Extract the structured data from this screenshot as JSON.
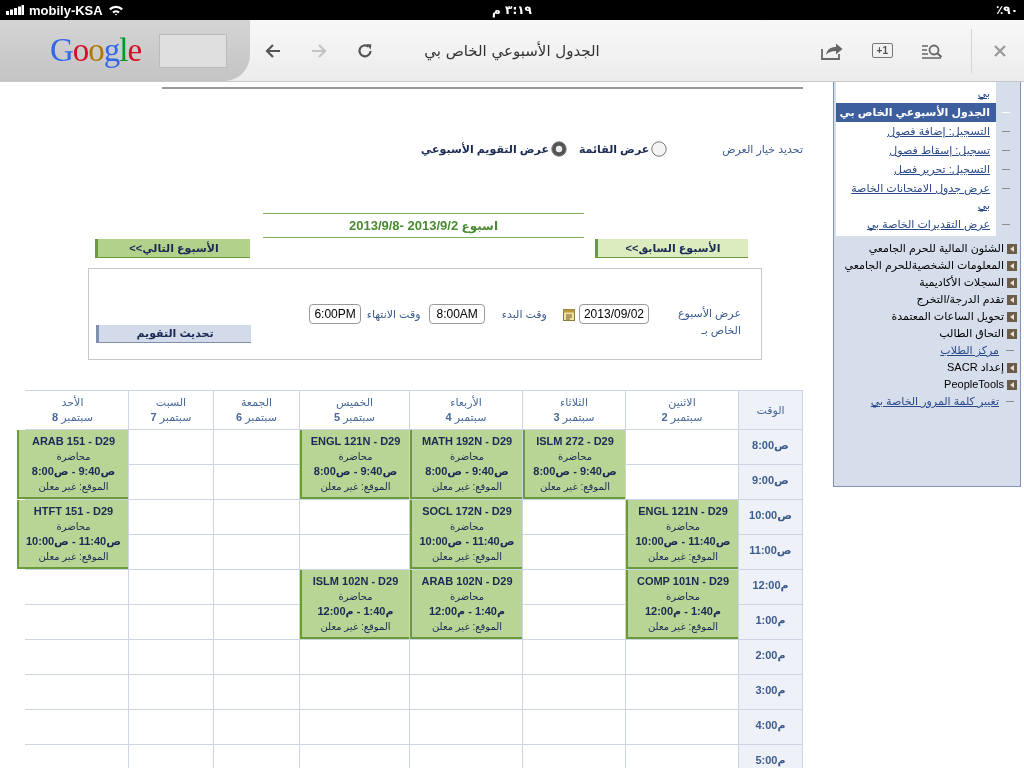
{
  "status_bar": {
    "carrier": "mobily-KSA",
    "time": "٣:١٩ م",
    "battery": "٪٩٠"
  },
  "browser": {
    "logo": "Google",
    "page_title": "الجدول الأسبوعي الخاص بي",
    "plus_one": "+1",
    "forward": {
      "disabled": true
    }
  },
  "view_options": {
    "label": "تحديد خيار العرض",
    "options": [
      {
        "label": "عرض القائمة",
        "selected": false
      },
      {
        "label": "عرض التقويم الأسبوعي",
        "selected": true
      }
    ]
  },
  "week": {
    "title": "اسبوع **2013/9/2 -2013/9/8**",
    "previous": "الأسبوع السابق>>",
    "next": "الأسبوع التالي>>"
  },
  "form": {
    "week_of_label": "عرض الأسبوع الخاص بـ",
    "date": "2013/09/02",
    "start_label": "وقت البدء",
    "start": "8:00AM",
    "end_label": "وقت الانتهاء",
    "end": "6:00PM",
    "refresh": "تحديث التقويم"
  },
  "schedule": {
    "time_heading": "الوقت",
    "days": [
      {
        "name": "الاثنين",
        "date": "سبتمبر **2**"
      },
      {
        "name": "الثلاثاء",
        "date": "سبتمبر **3**"
      },
      {
        "name": "الأربعاء",
        "date": "سبتمبر **4**"
      },
      {
        "name": "الخميس",
        "date": "سبتمبر **5**"
      },
      {
        "name": "الجمعة",
        "date": "سبتمبر **6**"
      },
      {
        "name": "السبت",
        "date": "سبتمبر **7**"
      },
      {
        "name": "الأحد",
        "date": "سبتمبر **8**"
      }
    ],
    "rows": [
      {
        "time": "8:00ص",
        "cells": [
          {
            "kind": "empty"
          },
          {
            "kind": "event",
            "course": "ISLM 272 - D29",
            "type": "محاضرة",
            "time": "8:00ص - 9:40ص",
            "location": "الموقع: غير معلن"
          },
          {
            "kind": "event",
            "course": "MATH 192N - D29",
            "type": "محاضرة",
            "time": "8:00ص - 9:40ص",
            "location": "الموقع: غير معلن"
          },
          {
            "kind": "event",
            "course": "ENGL 121N - D29",
            "type": "محاضرة",
            "time": "8:00ص - 9:40ص",
            "location": "الموقع: غير معلن"
          },
          {
            "kind": "empty"
          },
          {
            "kind": "empty"
          },
          {
            "kind": "event",
            "course": "ARAB 151 - D29",
            "type": "محاضرة",
            "time": "8:00ص - 9:40ص",
            "location": "الموقع: غير معلن"
          }
        ]
      },
      {
        "time": "9:00ص",
        "cells": [
          {
            "kind": "empty"
          },
          {
            "kind": "continued"
          },
          {
            "kind": "continued"
          },
          {
            "kind": "continued"
          },
          {
            "kind": "empty"
          },
          {
            "kind": "empty"
          },
          {
            "kind": "continued"
          }
        ]
      },
      {
        "time": "10:00ص",
        "cells": [
          {
            "kind": "event",
            "course": "ENGL 121N - D29",
            "type": "محاضرة",
            "time": "10:00ص - 11:40ص",
            "location": "الموقع: غير معلن"
          },
          {
            "kind": "empty"
          },
          {
            "kind": "event",
            "course": "SOCL 172N - D29",
            "type": "محاضرة",
            "time": "10:00ص - 11:40ص",
            "location": "الموقع: غير معلن"
          },
          {
            "kind": "empty"
          },
          {
            "kind": "empty"
          },
          {
            "kind": "empty"
          },
          {
            "kind": "event",
            "course": "HTFT 151 - D29",
            "type": "محاضرة",
            "time": "10:00ص - 11:40ص",
            "location": "الموقع: غير معلن"
          }
        ]
      },
      {
        "time": "11:00ص",
        "cells": [
          {
            "kind": "continued"
          },
          {
            "kind": "empty"
          },
          {
            "kind": "continued"
          },
          {
            "kind": "empty"
          },
          {
            "kind": "empty"
          },
          {
            "kind": "empty"
          },
          {
            "kind": "continued"
          }
        ]
      },
      {
        "time": "12:00م",
        "cells": [
          {
            "kind": "event",
            "course": "COMP 101N - D29",
            "type": "محاضرة",
            "time": "12:00م - 1:40م",
            "location": "الموقع: غير معلن"
          },
          {
            "kind": "empty"
          },
          {
            "kind": "event",
            "course": "ARAB 102N - D29",
            "type": "محاضرة",
            "time": "12:00م - 1:40م",
            "location": "الموقع: غير معلن"
          },
          {
            "kind": "event",
            "course": "ISLM 102N - D29",
            "type": "محاضرة",
            "time": "12:00م - 1:40م",
            "location": "الموقع: غير معلن"
          },
          {
            "kind": "empty"
          },
          {
            "kind": "empty"
          },
          {
            "kind": "empty"
          }
        ]
      },
      {
        "time": "1:00م",
        "cells": [
          {
            "kind": "continued"
          },
          {
            "kind": "empty"
          },
          {
            "kind": "continued"
          },
          {
            "kind": "continued"
          },
          {
            "kind": "empty"
          },
          {
            "kind": "empty"
          },
          {
            "kind": "empty"
          }
        ]
      },
      {
        "time": "2:00م",
        "cells": [
          {
            "kind": "empty"
          },
          {
            "kind": "empty"
          },
          {
            "kind": "empty"
          },
          {
            "kind": "empty"
          },
          {
            "kind": "empty"
          },
          {
            "kind": "empty"
          },
          {
            "kind": "empty"
          }
        ]
      },
      {
        "time": "3:00م",
        "cells": [
          {
            "kind": "empty"
          },
          {
            "kind": "empty"
          },
          {
            "kind": "empty"
          },
          {
            "kind": "empty"
          },
          {
            "kind": "empty"
          },
          {
            "kind": "empty"
          },
          {
            "kind": "empty"
          }
        ]
      },
      {
        "time": "4:00م",
        "cells": [
          {
            "kind": "empty"
          },
          {
            "kind": "empty"
          },
          {
            "kind": "empty"
          },
          {
            "kind": "empty"
          },
          {
            "kind": "empty"
          },
          {
            "kind": "empty"
          },
          {
            "kind": "empty"
          }
        ]
      },
      {
        "time": "5:00م",
        "cells": [
          {
            "kind": "empty"
          },
          {
            "kind": "empty"
          },
          {
            "kind": "empty"
          },
          {
            "kind": "empty"
          },
          {
            "kind": "empty"
          },
          {
            "kind": "empty"
          },
          {
            "kind": "empty"
          }
        ]
      }
    ]
  },
  "sidebar": {
    "sub_items": [
      {
        "label": "بي",
        "cut": true,
        "selected": false
      },
      {
        "label": "الجدول الأسبوعي الخاص بي",
        "cut": false,
        "selected": true
      },
      {
        "label": "التسجيل: إضافة فصول",
        "cut": false,
        "selected": false
      },
      {
        "label": "تسجيل: إسقاط فصول",
        "cut": false,
        "selected": false
      },
      {
        "label": "التسجيل: تحرير فصل",
        "cut": false,
        "selected": false
      },
      {
        "label": "عرض جدول الامتحانات الخاصة بي",
        "cut": false,
        "selected": false
      },
      {
        "label": "عرض التقديرات الخاصة بي",
        "cut": false,
        "selected": false
      }
    ],
    "items": [
      {
        "kind": "folder",
        "label": "الشئون المالية للحرم الجامعي"
      },
      {
        "kind": "folder",
        "label": "المعلومات الشخصيةللحرم الجامعي"
      },
      {
        "kind": "folder",
        "label": "السجلات الأكاديمية"
      },
      {
        "kind": "folder",
        "label": "تقدم الدرجة/التخرج"
      },
      {
        "kind": "folder",
        "label": "تحويل الساعات المعتمدة"
      },
      {
        "kind": "folder",
        "label": "التحاق الطالب"
      },
      {
        "kind": "link",
        "label": "مركز الطلاب"
      },
      {
        "kind": "folder",
        "label": "إعداد SACR"
      },
      {
        "kind": "folder",
        "label": "PeopleTools"
      },
      {
        "kind": "link",
        "label": "تغيير كلمة المرور الخاصة بي"
      }
    ]
  }
}
